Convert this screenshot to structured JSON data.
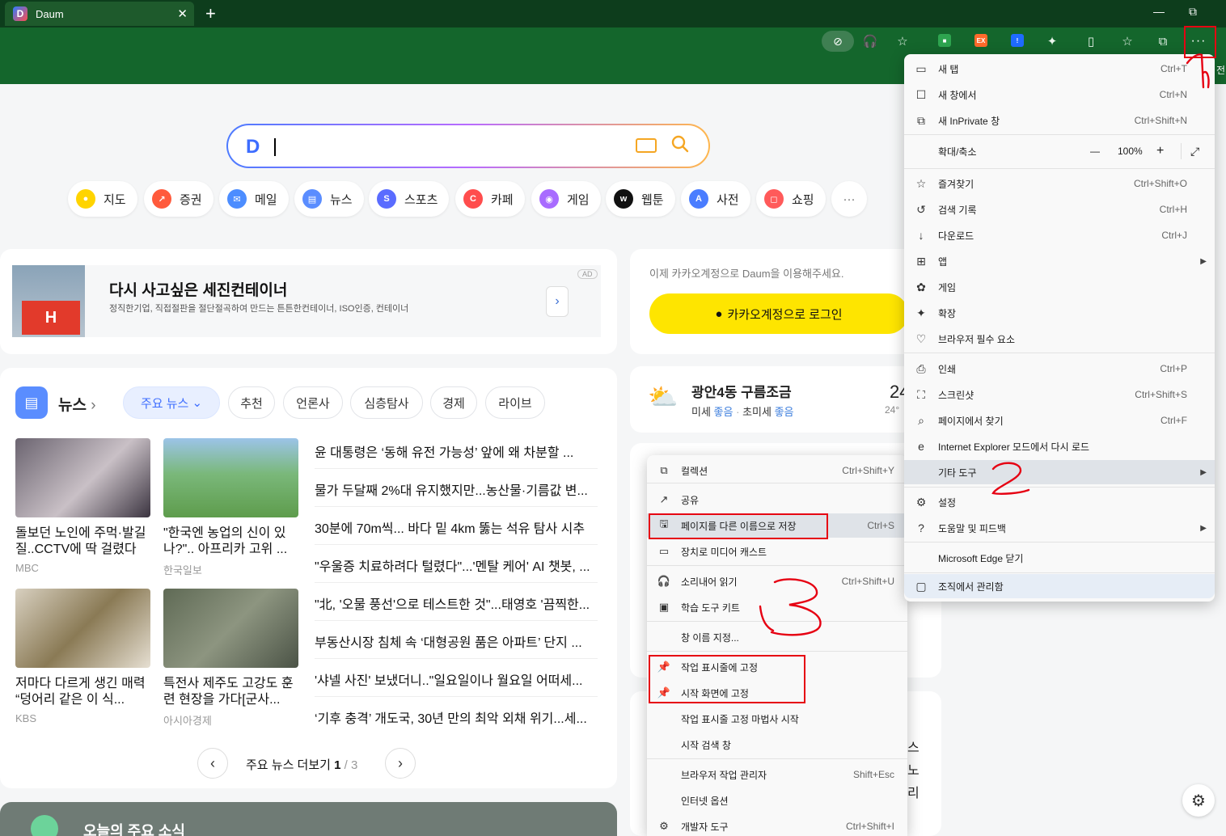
{
  "browser": {
    "tab_title": "Daum",
    "tab_logo": "D",
    "new_tab_icon": "+",
    "close_icon": "✕",
    "minimize_icon": "—",
    "restore_icon": "⧉",
    "menu_icon": "···",
    "favorites_cutoff_text": "전"
  },
  "page": {
    "search_logo": "D",
    "services": [
      {
        "label": "지도",
        "color": "#ffd400",
        "glyph": "●"
      },
      {
        "label": "증권",
        "color": "#ff5a3c",
        "glyph": "↗"
      },
      {
        "label": "메일",
        "color": "#4c8dff",
        "glyph": "✉"
      },
      {
        "label": "뉴스",
        "color": "#5a8dff",
        "glyph": "▤"
      },
      {
        "label": "스포츠",
        "color": "#5a6cff",
        "glyph": "S"
      },
      {
        "label": "카페",
        "color": "#ff4d4d",
        "glyph": "C"
      },
      {
        "label": "게임",
        "color": "#a86bff",
        "glyph": "◉"
      },
      {
        "label": "웹툰",
        "color": "#111111",
        "glyph": "w"
      },
      {
        "label": "사전",
        "color": "#4a7dff",
        "glyph": "A"
      },
      {
        "label": "쇼핑",
        "color": "#ff5a5a",
        "glyph": "◻"
      }
    ],
    "more_icon": "···",
    "ad": {
      "title": "다시 사고싶은 세진컨테이너",
      "desc": "정직한기업, 직접절판을 절단절곡하여 만드는 튼튼한컨테이너, ISO인증, 컨테이너",
      "badge": "AD",
      "image_text": "H"
    },
    "login": {
      "prompt": "이제 카카오계정으로 Daum을 이용해주세요.",
      "button": "카카오계정으로 로그인"
    },
    "weather": {
      "location": "광안4동 구름조금",
      "dust_label": "미세",
      "dust_value": "좋음",
      "fine_dust_label": "초미세",
      "fine_dust_value": "좋음",
      "temp": "24",
      "temp_sub": "24°"
    },
    "news": {
      "section_title": "뉴스",
      "tabs": [
        "주요 뉴스",
        "추천",
        "언론사",
        "심층탐사",
        "경제",
        "라이브"
      ],
      "thumbs": [
        {
          "title": "돌보던 노인에 주먹·발길질..CCTV에 딱 걸렸다",
          "source": "MBC"
        },
        {
          "title": "\"한국엔 농업의 신이 있나?\".. 아프리카 고위 ...",
          "source": "한국일보"
        },
        {
          "title": "저마다 다르게 생긴 매력 “덩어리 같은 이 식...",
          "source": "KBS"
        },
        {
          "title": "특전사 제주도 고강도 훈련 현장을 가다[군사...",
          "source": "아시아경제"
        }
      ],
      "headlines": [
        "윤 대통령은 ‘동해 유전 가능성’ 앞에 왜 차분할 ...",
        "물가 두달째 2%대 유지했지만...농산물·기름값 변...",
        "30분에 70m씩... 바다 밑 4km 뚫는 석유 탐사 시추",
        "\"우울증 치료하려다 털렸다\"...'멘탈 케어' AI 챗봇, ...",
        "\"北, '오물 풍선'으로 테스트한 것\"...태영호 '끔찍한...",
        "부동산시장 침체 속 ‘대형공원 품은 아파트’ 단지 ...",
        "'샤넬 사진' 보냈더니..\"일요일이나 월요일 어떠세...",
        "‘기후 충격’ 개도국, 30년 만의 최악 외채 위기...세..."
      ],
      "more_label": "주요 뉴스 더보기",
      "page_current": "1",
      "page_total": "/ 3"
    },
    "bottom_banner": "오늘의 주요 소식",
    "right_edge_text": [
      "스",
      "노",
      "리"
    ]
  },
  "menu": {
    "items": [
      {
        "label": "새 탭",
        "shortcut": "Ctrl+T",
        "icon": "new-tab-icon",
        "glyph": "▭"
      },
      {
        "label": "새 창에서",
        "shortcut": "Ctrl+N",
        "icon": "new-window-icon",
        "glyph": "☐"
      },
      {
        "label": "새 InPrivate 창",
        "shortcut": "Ctrl+Shift+N",
        "icon": "inprivate-icon",
        "glyph": "⧉"
      }
    ],
    "zoom": {
      "label": "확대/축소",
      "minus": "—",
      "value": "100%",
      "plus": "+",
      "expand": "⤢"
    },
    "items2": [
      {
        "label": "즐겨찾기",
        "shortcut": "Ctrl+Shift+O",
        "glyph": "☆"
      },
      {
        "label": "검색 기록",
        "shortcut": "Ctrl+H",
        "glyph": "↺"
      },
      {
        "label": "다운로드",
        "shortcut": "Ctrl+J",
        "glyph": "↓"
      },
      {
        "label": "앱",
        "shortcut": "",
        "glyph": "⊞",
        "arrow": "▶"
      },
      {
        "label": "게임",
        "shortcut": "",
        "glyph": "✿"
      },
      {
        "label": "확장",
        "shortcut": "",
        "glyph": "✦"
      },
      {
        "label": "브라우저 필수 요소",
        "shortcut": "",
        "glyph": "♡"
      }
    ],
    "items3": [
      {
        "label": "인쇄",
        "shortcut": "Ctrl+P",
        "glyph": "⎙"
      },
      {
        "label": "스크린샷",
        "shortcut": "Ctrl+Shift+S",
        "glyph": "⛶"
      },
      {
        "label": "페이지에서 찾기",
        "shortcut": "Ctrl+F",
        "glyph": "⌕"
      },
      {
        "label": "Internet Explorer 모드에서 다시 로드",
        "shortcut": "",
        "glyph": "e"
      }
    ],
    "more_tools": {
      "label": "기타 도구",
      "arrow": "▶"
    },
    "items4": [
      {
        "label": "설정",
        "glyph": "⚙",
        "arrow": ""
      },
      {
        "label": "도움말 및 피드백",
        "glyph": "?",
        "arrow": "▶"
      }
    ],
    "close_edge": "Microsoft Edge 닫기",
    "managed": {
      "label": "조직에서 관리함",
      "glyph": "▢"
    }
  },
  "submenu": {
    "items": [
      {
        "label": "컬렉션",
        "shortcut": "Ctrl+Shift+Y",
        "glyph": "⧉"
      },
      {
        "label": "공유",
        "shortcut": "",
        "glyph": "↗"
      },
      {
        "label": "페이지를 다른 이름으로 저장",
        "shortcut": "Ctrl+S",
        "glyph": "🖫"
      },
      {
        "label": "장치로 미디어 캐스트",
        "shortcut": "",
        "glyph": "▭"
      },
      {
        "label": "소리내어 읽기",
        "shortcut": "Ctrl+Shift+U",
        "glyph": "🎧"
      },
      {
        "label": "학습 도구 키트",
        "shortcut": "",
        "glyph": "▣"
      },
      {
        "label": "창 이름 지정...",
        "shortcut": "",
        "glyph": ""
      },
      {
        "label": "작업 표시줄에 고정",
        "shortcut": "",
        "glyph": "📌"
      },
      {
        "label": "시작 화면에 고정",
        "shortcut": "",
        "glyph": "📌"
      },
      {
        "label": "작업 표시줄 고정 마법사 시작",
        "shortcut": "",
        "glyph": ""
      },
      {
        "label": "시작 검색 창",
        "shortcut": "",
        "glyph": ""
      },
      {
        "label": "브라우저 작업 관리자",
        "shortcut": "Shift+Esc",
        "glyph": ""
      },
      {
        "label": "인터넷 옵션",
        "shortcut": "",
        "glyph": ""
      },
      {
        "label": "개발자 도구",
        "shortcut": "Ctrl+Shift+I",
        "glyph": "⚙"
      }
    ]
  },
  "colors": {
    "annotation": "#e60012",
    "kakao": "#fee500",
    "browser_green": "#14662c"
  }
}
